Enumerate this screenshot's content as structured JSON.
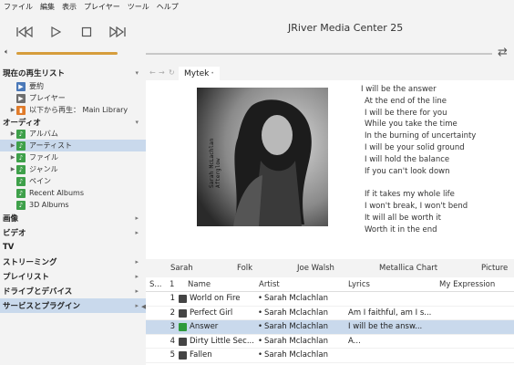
{
  "menu": [
    "ファイル",
    "編集",
    "表示",
    "プレイヤー",
    "ツール",
    "ヘルプ"
  ],
  "app_title": "JRiver Media Center 25",
  "transport": {
    "prev": "|◁◁",
    "play": "▷",
    "stop": "□",
    "next": "▷▷|"
  },
  "sidebar": {
    "now_playing": "現在の再生リスト",
    "summary": "要約",
    "player": "プレイヤー",
    "play_from": "以下から再生： Main Library",
    "audio": "オーディオ",
    "album": "アルバム",
    "artist": "アーティスト",
    "file": "ファイル",
    "genre": "ジャンル",
    "page": "ペイン",
    "recent_albums": "Recent Albums",
    "albums_3d": "3D Albums",
    "images": "画像",
    "video": "ビデオ",
    "tv": "TV",
    "streaming": "ストリーミング",
    "playlist": "プレイリスト",
    "drives": "ドライブとデバイス",
    "services": "サービスとプラグイン"
  },
  "tab": {
    "label": "Mytek",
    "close": "•"
  },
  "lyrics": [
    "I will be the answer",
    "At the end of the line",
    "I will be there for you",
    "While you take the time",
    "In the burning of uncertainty",
    "I will be your solid ground",
    "I will hold the balance",
    "If you can't look down",
    "",
    "If it takes my whole life",
    "I won't break, I won't bend",
    "It will all be worth it",
    "Worth it in the end"
  ],
  "album_art_caption": "Sarah McLachlan\nAfterglow",
  "categories": [
    "Sarah",
    "Folk",
    "Joe Walsh",
    "Metallica Chart",
    "Picture"
  ],
  "grid": {
    "columns": {
      "s": "S...",
      "n": "1",
      "name": "Name",
      "artist": "Artist",
      "lyrics": "Lyrics",
      "expr": "My Expression"
    },
    "rows": [
      {
        "num": "1",
        "name": "World on Fire",
        "artist": "Sarah Mclachlan",
        "lyrics": "",
        "playing": false
      },
      {
        "num": "2",
        "name": "Perfect Girl",
        "artist": "Sarah Mclachlan",
        "lyrics": "Am I faithful, am I s...",
        "playing": false
      },
      {
        "num": "3",
        "name": "Answer",
        "artist": "Sarah Mclachlan",
        "lyrics": "I will be the answ...",
        "playing": true
      },
      {
        "num": "4",
        "name": "Dirty Little Sec...",
        "artist": "Sarah Mclachlan",
        "lyrics": "A...",
        "playing": false
      },
      {
        "num": "5",
        "name": "Fallen",
        "artist": "Sarah Mclachlan",
        "lyrics": "",
        "playing": false
      }
    ]
  },
  "colors": {
    "accent": "#d69d3c",
    "selection": "#c9d9ec",
    "playing_icon": "#2f9a3c"
  }
}
